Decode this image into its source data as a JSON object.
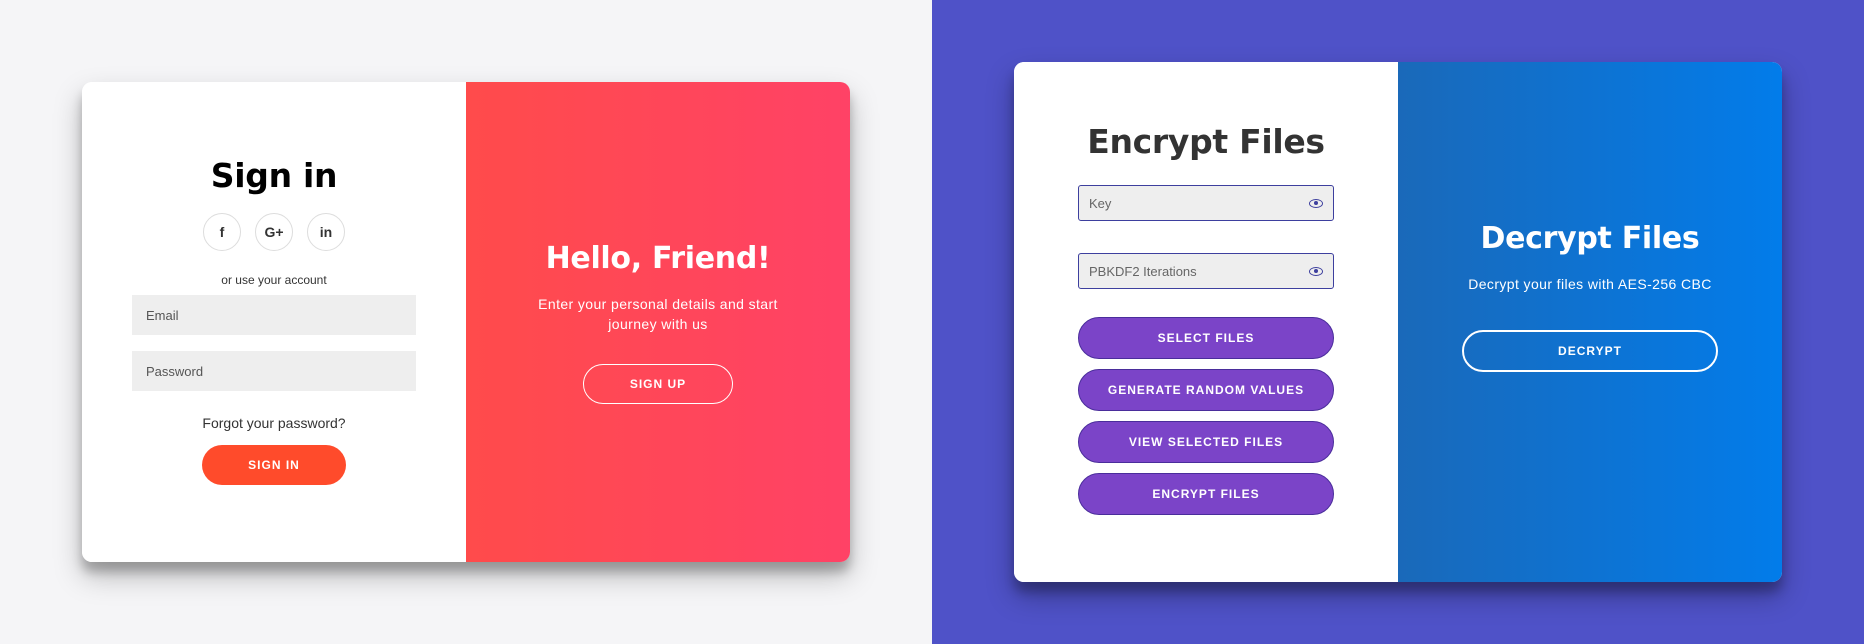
{
  "signin": {
    "title": "Sign in",
    "social": {
      "facebook": "f",
      "google": "G+",
      "linkedin": "in"
    },
    "alt_text": "or use your account",
    "email_placeholder": "Email",
    "password_placeholder": "Password",
    "forgot": "Forgot your password?",
    "button": "SIGN IN"
  },
  "hello": {
    "title": "Hello, Friend!",
    "text": "Enter your personal details and start journey with us",
    "button": "SIGN UP"
  },
  "encrypt": {
    "title": "Encrypt Files",
    "key_placeholder": "Key",
    "iterations_placeholder": "PBKDF2 Iterations",
    "buttons": [
      "SELECT FILES",
      "GENERATE RANDOM VALUES",
      "VIEW SELECTED FILES",
      "ENCRYPT FILES"
    ]
  },
  "decrypt": {
    "title": "Decrypt Files",
    "text": "Decrypt your files with AES-256 CBC",
    "button": "DECRYPT"
  },
  "colors": {
    "left_bg": "#f5f5f7",
    "right_bg": "#4f52c8",
    "accent_red": "#ff4b2b",
    "accent_purple": "#7b44c8",
    "accent_blue": "#027cea"
  }
}
